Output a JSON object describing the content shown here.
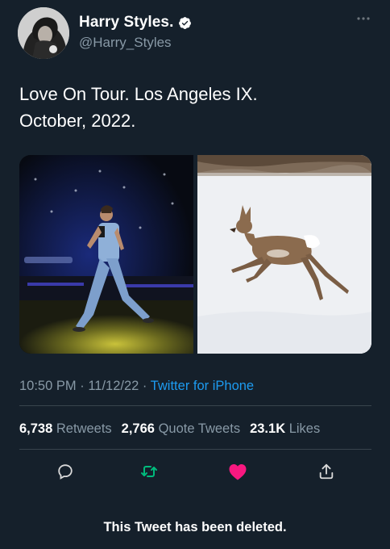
{
  "author": {
    "display_name": "Harry Styles.",
    "handle": "@Harry_Styles",
    "verified_icon": "verified-badge-icon",
    "more_icon": "more-options-icon"
  },
  "tweet": {
    "text_line1": "Love On Tour. Los Angeles IX.",
    "text_line2": "October, 2022."
  },
  "media": {
    "left_image": "performer-on-stage-photo",
    "right_image": "deer-leaping-in-snow-photo"
  },
  "meta": {
    "time": "10:50 PM",
    "date": "11/12/22",
    "source": "Twitter for iPhone",
    "separator": "·"
  },
  "stats": {
    "retweets_count": "6,738",
    "retweets_label": "Retweets",
    "quotes_count": "2,766",
    "quotes_label": "Quote Tweets",
    "likes_count": "23.1K",
    "likes_label": "Likes"
  },
  "actions": {
    "reply_icon": "reply-icon",
    "retweet_icon": "retweet-icon",
    "like_icon": "heart-icon",
    "share_icon": "share-icon"
  },
  "quoted": {
    "deleted_text": "This Tweet has been deleted."
  },
  "colors": {
    "background": "#15202b",
    "secondary_text": "#8899a6",
    "link": "#1d9bf0",
    "retweet_green": "#00ba7c",
    "like_pink": "#f91880"
  }
}
